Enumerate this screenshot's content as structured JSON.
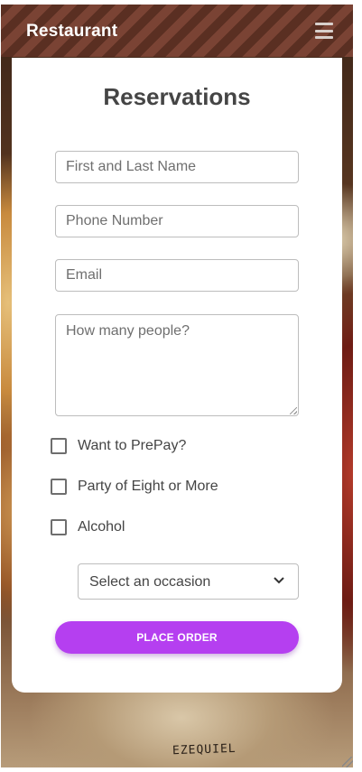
{
  "header": {
    "brand": "Restaurant",
    "menu_icon": "hamburger-icon",
    "colors": {
      "stripe_dark": "#5a2f22",
      "stripe_light": "#7a4334"
    }
  },
  "form": {
    "title": "Reservations",
    "name_placeholder": "First and Last Name",
    "phone_placeholder": "Phone Number",
    "email_placeholder": "Email",
    "people_placeholder": "How many people?",
    "checkboxes": [
      {
        "label": "Want to PrePay?",
        "checked": false
      },
      {
        "label": "Party of Eight or More",
        "checked": false
      },
      {
        "label": "Alcohol",
        "checked": false
      }
    ],
    "occasion": {
      "selected": "Select an occasion",
      "icon": "chevron-down-icon"
    },
    "submit_label": "PLACE ORDER",
    "accent_color": "#b53ff0"
  },
  "background": {
    "signature": "EZEQUIEL"
  }
}
